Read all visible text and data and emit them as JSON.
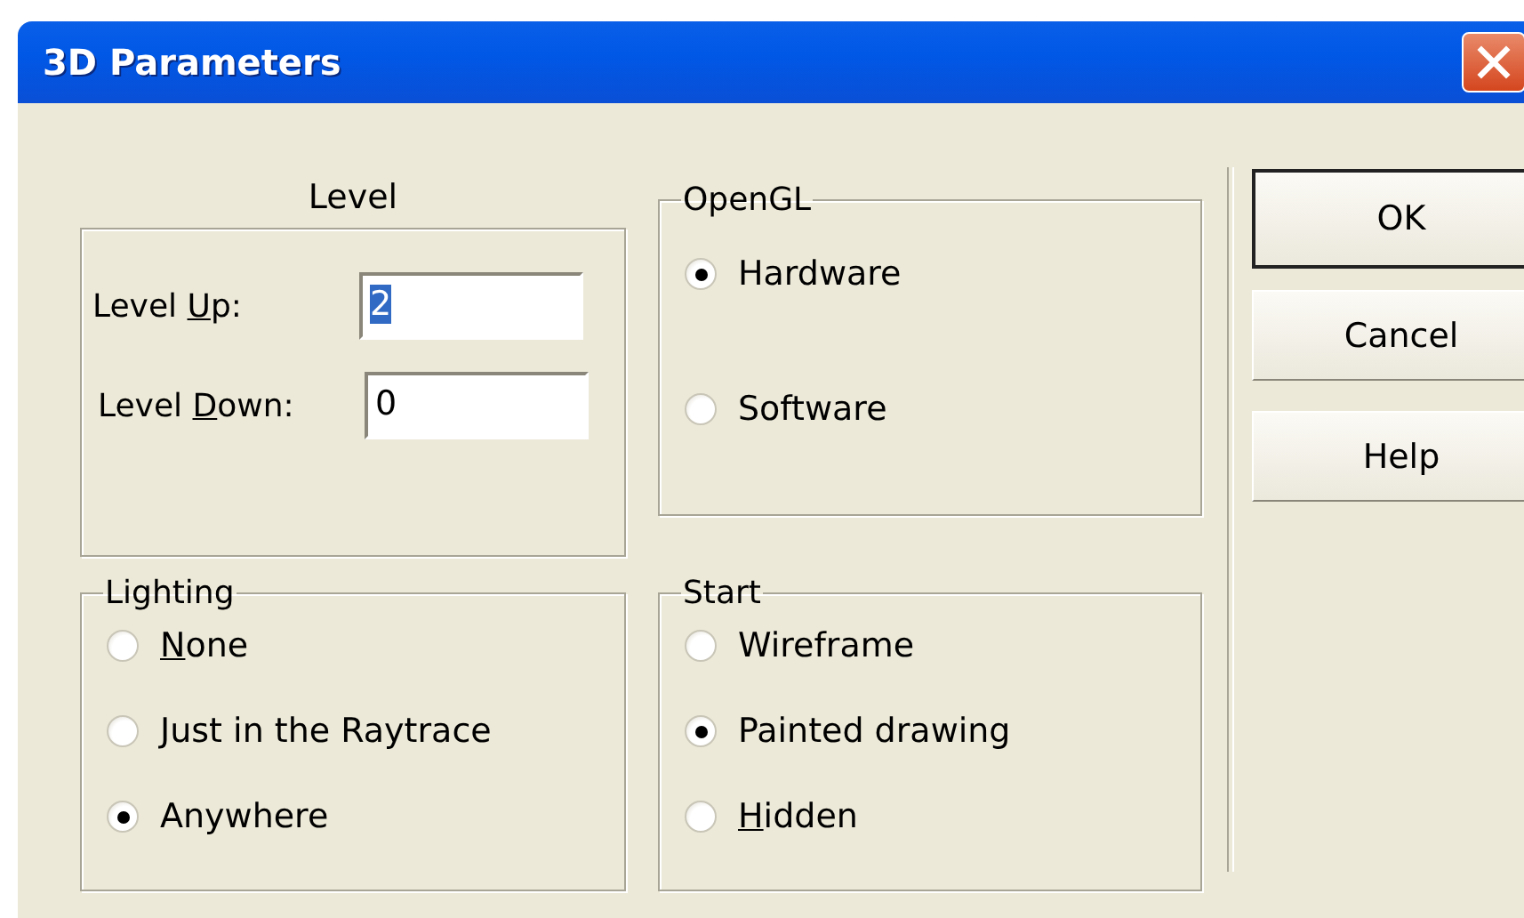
{
  "window": {
    "title": "3D Parameters"
  },
  "level": {
    "title": "Level",
    "fields": [
      {
        "label": [
          {
            "text": "Level ",
            "access_key": false
          },
          {
            "text": "U",
            "access_key": true
          },
          {
            "text": "p:",
            "access_key": false
          }
        ],
        "value": "2",
        "value_selected": true
      },
      {
        "label": [
          {
            "text": "Level ",
            "access_key": false
          },
          {
            "text": "D",
            "access_key": true
          },
          {
            "text": "own:",
            "access_key": false
          }
        ],
        "value": "0",
        "value_selected": false
      }
    ]
  },
  "opengl": {
    "title": "OpenGL",
    "options": [
      {
        "label": [
          {
            "text": "Hardware",
            "access_key": false
          }
        ],
        "selected": true
      },
      {
        "label": [
          {
            "text": "Software",
            "access_key": false
          }
        ],
        "selected": false
      }
    ]
  },
  "lighting": {
    "title": "Lighting",
    "options": [
      {
        "label": [
          {
            "text": "N",
            "access_key": true
          },
          {
            "text": "one",
            "access_key": false
          }
        ],
        "selected": false
      },
      {
        "label": [
          {
            "text": "Just in the Raytrace",
            "access_key": false
          }
        ],
        "selected": false
      },
      {
        "label": [
          {
            "text": "Anywhere",
            "access_key": false
          }
        ],
        "selected": true
      }
    ]
  },
  "start": {
    "title": "Start",
    "options": [
      {
        "label": [
          {
            "text": "Wireframe",
            "access_key": false
          }
        ],
        "selected": false
      },
      {
        "label": [
          {
            "text": "Painted drawing",
            "access_key": false
          }
        ],
        "selected": true
      },
      {
        "label": [
          {
            "text": "H",
            "access_key": true
          },
          {
            "text": "idden",
            "access_key": false
          }
        ],
        "selected": false
      }
    ]
  },
  "buttons": [
    {
      "label": "OK",
      "default": true
    },
    {
      "label": "Cancel",
      "default": false
    },
    {
      "label": "Help",
      "default": false
    }
  ]
}
